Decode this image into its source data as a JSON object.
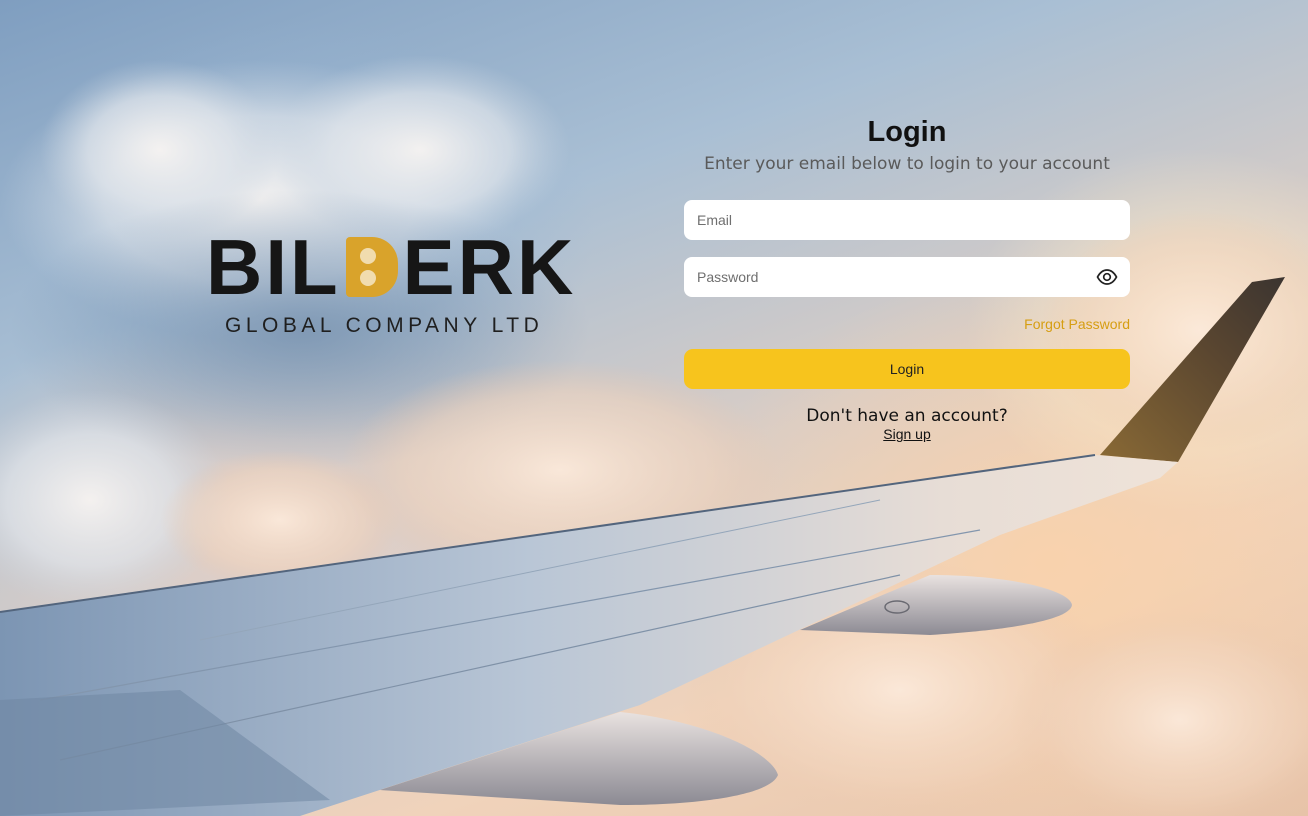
{
  "brand": {
    "name_left": "BIL",
    "name_right": "ERK",
    "tagline": "GLOBAL COMPANY LTD",
    "accent_color": "#d9a32b"
  },
  "login": {
    "title": "Login",
    "subtitle": "Enter your email below to login to your account",
    "email_placeholder": "Email",
    "password_placeholder": "Password",
    "password_toggle_icon": "eye-icon",
    "forgot_password": "Forgot Password",
    "submit_label": "Login",
    "submit_color": "#f7c41d",
    "no_account_text": "Don't have an account?",
    "signup_link": "Sign up"
  }
}
